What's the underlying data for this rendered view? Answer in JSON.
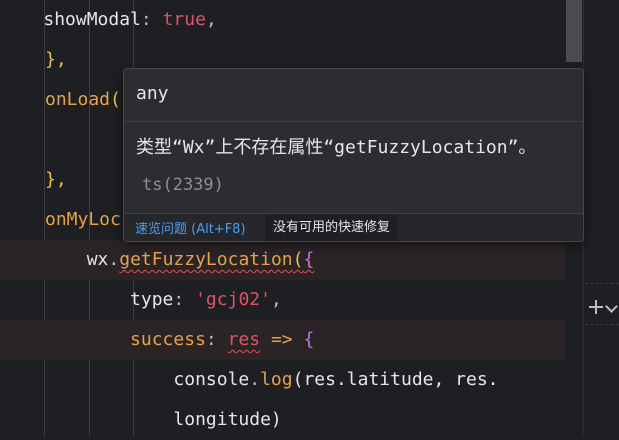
{
  "code": {
    "line1": {
      "indent": "    ",
      "key": "showModal",
      "colon": ": ",
      "value": "true",
      "end": ","
    },
    "line2": {
      "text": "},"
    },
    "line3": {
      "fn": "onLoad",
      "paren": "("
    },
    "line4": {
      "text": "},"
    },
    "line5": {
      "fn": "onMyLoc"
    },
    "line6": {
      "obj": "wx",
      "dot": ".",
      "method": "getFuzzyLocation",
      "paren": "(",
      "brace": "{"
    },
    "line7": {
      "key": "type",
      "colon": ": ",
      "value": "'gcj02'",
      "end": ","
    },
    "line8": {
      "key": "success",
      "colon": ": ",
      "param": "res",
      "arrow": " => ",
      "brace": "{"
    },
    "line9": {
      "obj": "console",
      "dot": ".",
      "method": "log",
      "args": "(res.latitude, res."
    },
    "line10": {
      "args": "longitude)"
    }
  },
  "hover": {
    "type_text": "any",
    "message": "类型“Wx”上不存在属性“getFuzzyLocation”。",
    "code": "ts(2339)",
    "view_problem": "速览问题 (Alt+F8)",
    "no_quick_fix": "没有可用的快速修复"
  },
  "colors": {
    "background": "#1e1f22",
    "keyword": "#e0526b",
    "function": "#e5a24a",
    "link": "#4f9cf2"
  }
}
